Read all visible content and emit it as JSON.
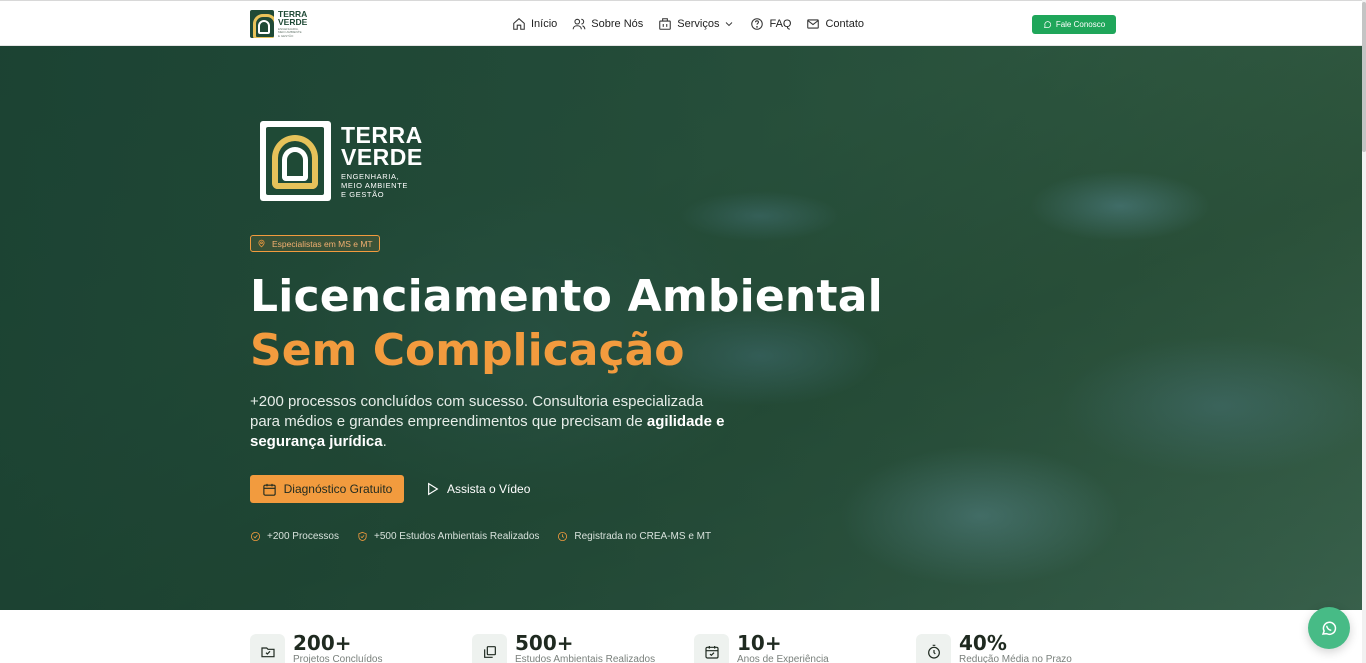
{
  "header": {
    "logo_title_1": "TERRA",
    "logo_title_2": "VERDE",
    "logo_sub_1": "ENGENHARIA,",
    "logo_sub_2": "MEIO AMBIENTE",
    "logo_sub_3": "E GESTÃO",
    "nav": [
      {
        "label": "Início",
        "icon": "home-icon"
      },
      {
        "label": "Sobre Nós",
        "icon": "users-icon"
      },
      {
        "label": "Serviços",
        "icon": "building-icon"
      },
      {
        "label": "FAQ",
        "icon": "help-circle-icon"
      },
      {
        "label": "Contato",
        "icon": "mail-icon"
      }
    ],
    "cta": "Fale Conosco"
  },
  "hero": {
    "logo_title_1": "TERRA",
    "logo_title_2": "VERDE",
    "logo_sub_1": "ENGENHARIA,",
    "logo_sub_2": "MEIO AMBIENTE",
    "logo_sub_3": "E GESTÃO",
    "badge": "Especialistas em MS e MT",
    "title_line1": "Licenciamento Ambiental",
    "title_line2": "Sem Complicação",
    "lead_text": "+200 processos concluídos com sucesso. Consultoria especializada para médios e grandes empreendimentos que precisam de ",
    "lead_bold": "agilidade e segurança jurídica",
    "lead_end": ".",
    "primary_button": "Diagnóstico Gratuito",
    "video_button": "Assista o Vídeo",
    "trust": [
      "+200 Processos",
      "+500 Estudos Ambientais Realizados",
      "Registrada no CREA-MS e MT"
    ]
  },
  "stats": [
    {
      "value": "200+",
      "label": "Projetos Concluídos",
      "icon": "folder-check-icon"
    },
    {
      "value": "500+",
      "label": "Estudos Ambientais Realizados",
      "icon": "copy-icon"
    },
    {
      "value": "10+",
      "label": "Anos de Experiência",
      "icon": "calendar-check-icon"
    },
    {
      "value": "40%",
      "label": "Redução Média no Prazo",
      "icon": "timer-icon"
    }
  ],
  "colors": {
    "brand_green": "#1f4a36",
    "accent_orange": "#f29b3e",
    "whatsapp_green": "#1fa65a"
  }
}
